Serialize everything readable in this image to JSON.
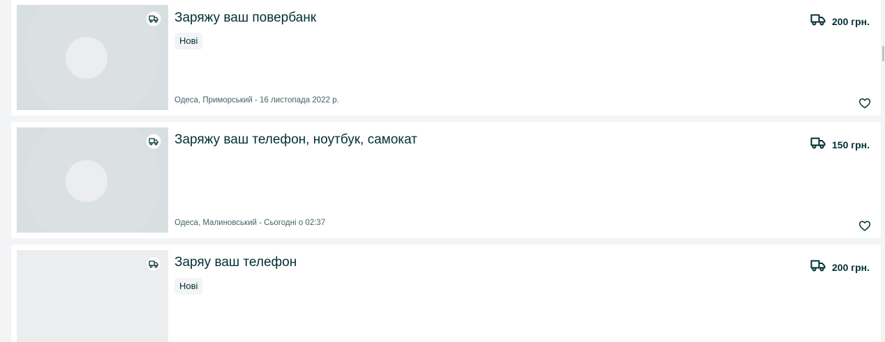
{
  "listings": [
    {
      "title": "Заряжу ваш повербанк",
      "tag": "Нові",
      "meta": "Одеса, Приморський - 16 листопада 2022 р.",
      "price": "200 грн.",
      "image": "placeholder-image",
      "delivery_icon": "truck-icon",
      "favorite_icon": "heart-outline-icon"
    },
    {
      "title": "Заряжу ваш телефон, ноутбук, самокат",
      "meta": "Одеса, Малиновський - Сьогодні о 02:37",
      "price": "150 грн.",
      "image": "placeholder-image",
      "delivery_icon": "truck-icon",
      "favorite_icon": "heart-outline-icon"
    },
    {
      "title": "Заряу ваш телефон",
      "tag": "Нові",
      "price": "200 грн.",
      "image": "loading-image",
      "delivery_icon": "truck-icon"
    }
  ],
  "colors": {
    "text": "#002f34",
    "meta": "#406367",
    "page_bg": "#f2f4f5",
    "placeholder": "#d8dfe0"
  }
}
